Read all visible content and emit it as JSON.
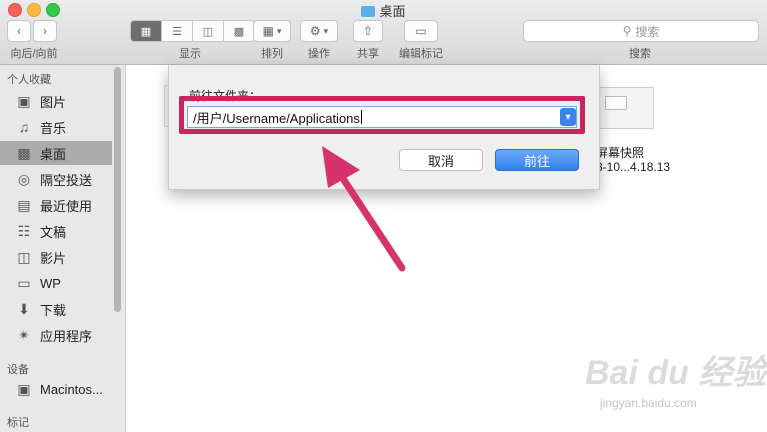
{
  "window": {
    "title": "桌面"
  },
  "toolbar": {
    "nav_label": "向后/向前",
    "view_label": "显示",
    "arrange_label": "排列",
    "action_label": "操作",
    "share_label": "共享",
    "tags_label": "编辑标记",
    "search_label": "搜索",
    "search_placeholder": "搜索"
  },
  "sidebar": {
    "favorites_header": "个人收藏",
    "items": [
      {
        "label": "图片",
        "icon": "camera-icon"
      },
      {
        "label": "音乐",
        "icon": "music-note-icon"
      },
      {
        "label": "桌面",
        "icon": "desktop-icon",
        "selected": true
      },
      {
        "label": "隔空投送",
        "icon": "airdrop-icon"
      },
      {
        "label": "最近使用",
        "icon": "recents-icon"
      },
      {
        "label": "文稿",
        "icon": "document-icon"
      },
      {
        "label": "影片",
        "icon": "film-icon"
      },
      {
        "label": "WP",
        "icon": "folder-icon"
      },
      {
        "label": "下载",
        "icon": "download-icon"
      },
      {
        "label": "应用程序",
        "icon": "applications-icon"
      }
    ],
    "devices_header": "设备",
    "devices": [
      {
        "label": "Macintos...",
        "icon": "disk-icon"
      }
    ],
    "tags_header": "标记"
  },
  "content": {
    "file_name_line1": "屏幕快照",
    "file_name_line2": "8-10...4.18.13"
  },
  "dialog": {
    "label": "前往文件夹：",
    "path_value": "/用户/Username/Applications",
    "cancel_label": "取消",
    "go_label": "前往"
  },
  "watermark": {
    "text": "Bai du 经验",
    "sub": "jingyan.baidu.com"
  },
  "colors": {
    "highlight": "#c5285e",
    "accent": "#3b84ea"
  }
}
